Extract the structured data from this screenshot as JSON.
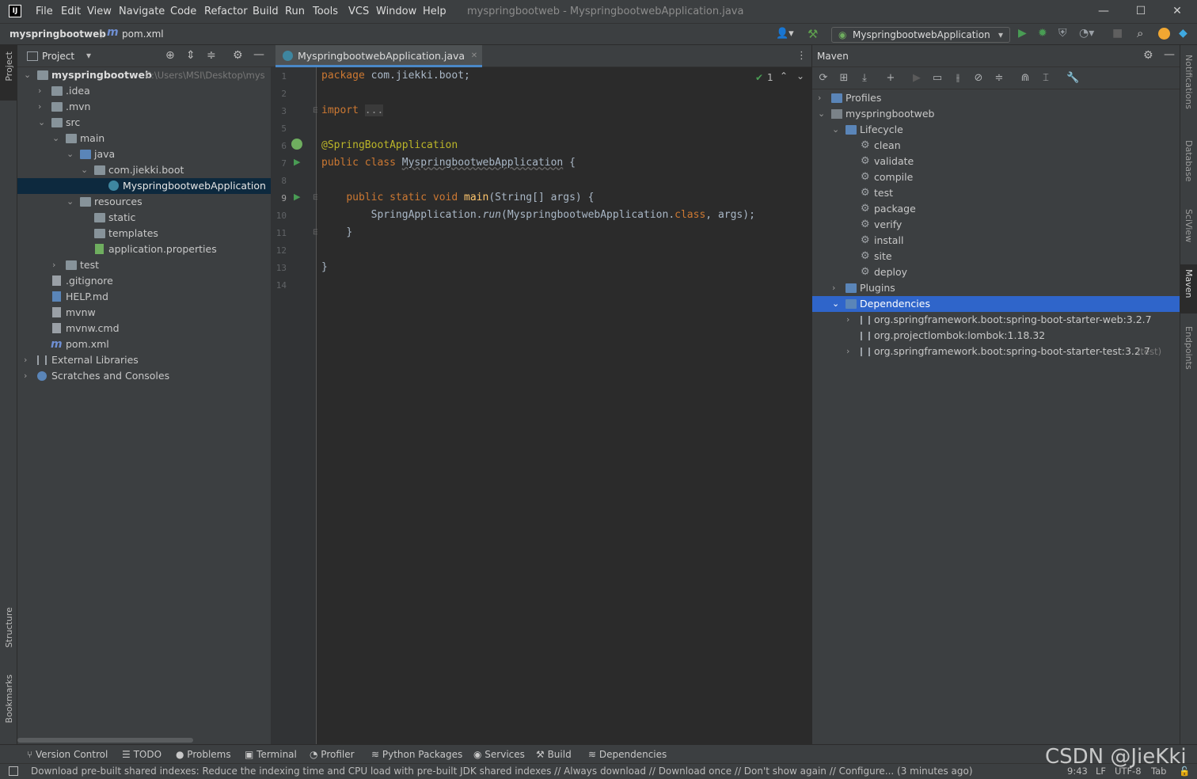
{
  "menubar": {
    "items": [
      "File",
      "Edit",
      "View",
      "Navigate",
      "Code",
      "Refactor",
      "Build",
      "Run",
      "Tools",
      "VCS",
      "Window",
      "Help"
    ],
    "window_title": "myspringbootweb - MyspringbootwebApplication.java"
  },
  "navbar": {
    "project": "myspringbootweb",
    "file": "pom.xml",
    "run_config": "MyspringbootwebApplication"
  },
  "left_stripe": {
    "project": "Project",
    "structure": "Structure",
    "bookmarks": "Bookmarks"
  },
  "right_stripe": {
    "notifications": "Notifications",
    "database": "Database",
    "sciview": "SciView",
    "maven": "Maven",
    "endpoints": "Endpoints"
  },
  "project_panel": {
    "title": "Project",
    "tree": [
      {
        "label": "myspringbootweb",
        "path": "C:\\Users\\MSI\\Desktop\\mys"
      },
      {
        "label": ".idea"
      },
      {
        "label": ".mvn"
      },
      {
        "label": "src"
      },
      {
        "label": "main"
      },
      {
        "label": "java"
      },
      {
        "label": "com.jiekki.boot"
      },
      {
        "label": "MyspringbootwebApplication"
      },
      {
        "label": "resources"
      },
      {
        "label": "static"
      },
      {
        "label": "templates"
      },
      {
        "label": "application.properties"
      },
      {
        "label": "test"
      },
      {
        "label": ".gitignore"
      },
      {
        "label": "HELP.md"
      },
      {
        "label": "mvnw"
      },
      {
        "label": "mvnw.cmd"
      },
      {
        "label": "pom.xml"
      },
      {
        "label": "External Libraries"
      },
      {
        "label": "Scratches and Consoles"
      }
    ]
  },
  "editor": {
    "tab": "MyspringbootwebApplication.java",
    "check_count": "1",
    "line_numbers": [
      "1",
      "2",
      "3",
      "5",
      "6",
      "7",
      "8",
      "9",
      "10",
      "11",
      "12",
      "13",
      "14"
    ],
    "code": {
      "l1_kw": "package",
      "l1_rest": " com.jiekki.boot;",
      "l3_kw": "import",
      "l3_fold": "...",
      "l6": "@SpringBootApplication",
      "l7_kw": "public class",
      "l7_name": "MyspringbootwebApplication",
      "l7_rest": " {",
      "l9_kw": "public static void",
      "l9_fn": "main",
      "l9_rest": "(String[] args) {",
      "l10_a": "SpringApplication.",
      "l10_run": "run",
      "l10_b": "(MyspringbootwebApplication.",
      "l10_kw": "class",
      "l10_c": ", args);",
      "l11": "}",
      "l13": "}"
    }
  },
  "maven_panel": {
    "title": "Maven",
    "profiles": "Profiles",
    "project": "myspringbootweb",
    "lifecycle": "Lifecycle",
    "goals": [
      "clean",
      "validate",
      "compile",
      "test",
      "package",
      "verify",
      "install",
      "site",
      "deploy"
    ],
    "plugins": "Plugins",
    "dependencies": "Dependencies",
    "deps": [
      {
        "label": "org.springframework.boot:spring-boot-starter-web:3.2.7",
        "scope": ""
      },
      {
        "label": "org.projectlombok:lombok:1.18.32",
        "scope": ""
      },
      {
        "label": "org.springframework.boot:spring-boot-starter-test:3.2.7",
        "scope": "(test)"
      }
    ]
  },
  "bottom_tools": [
    "Version Control",
    "TODO",
    "Problems",
    "Terminal",
    "Profiler",
    "Python Packages",
    "Services",
    "Build",
    "Dependencies"
  ],
  "status": {
    "message": "Download pre-built shared indexes: Reduce the indexing time and CPU load with pre-built JDK shared indexes // Always download // Download once // Don't show again // Configure... (3 minutes ago)",
    "position": "9:43",
    "line_sep": "LF",
    "encoding": "UTF-8",
    "indent": "Tab"
  },
  "watermark": "CSDN @JieKki",
  "colors": {
    "selection": "#0d293e",
    "maven_selection": "#2f65ca",
    "keyword": "#cc7832",
    "annotation": "#bbb529",
    "function": "#ffc66d"
  }
}
